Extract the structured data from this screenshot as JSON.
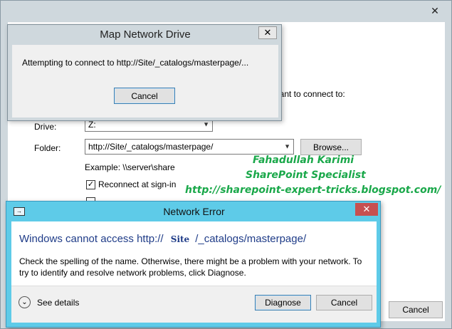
{
  "background_window": {
    "instruction": "want to connect to:",
    "drive_label": "Drive:",
    "drive_value": "Z:",
    "folder_label": "Folder:",
    "folder_value": "http://Site/_catalogs/masterpage/",
    "browse_label": "Browse...",
    "example": "Example: \\\\server\\share",
    "reconnect_label": "Reconnect at sign-in",
    "cancel_label": "Cancel"
  },
  "map_dialog": {
    "title": "Map Network Drive",
    "message": "Attempting to connect to http://Site/_catalogs/masterpage/...",
    "cancel_label": "Cancel"
  },
  "error_dialog": {
    "title": "Network Error",
    "heading_prefix": "Windows cannot access http://",
    "heading_site": "Site",
    "heading_suffix": "/_catalogs/masterpage/",
    "message": "Check the spelling of the name. Otherwise, there might be a problem with your network. To try to identify and resolve network problems, click Diagnose.",
    "see_details": "See details",
    "diagnose_label": "Diagnose",
    "cancel_label": "Cancel"
  },
  "watermark": {
    "name": "Fahadullah Karimi",
    "role": "SharePoint Specialist",
    "url": "http://sharepoint-expert-tricks.blogspot.com/"
  },
  "icons": {
    "close": "close-icon",
    "chevron": "chevron-down-icon",
    "network_error": "network-error-icon"
  },
  "colors": {
    "error_title_bar": "#5ecbe8",
    "error_close": "#c75050",
    "heading_text": "#1f3c88",
    "watermark_text": "#1aa84a"
  }
}
